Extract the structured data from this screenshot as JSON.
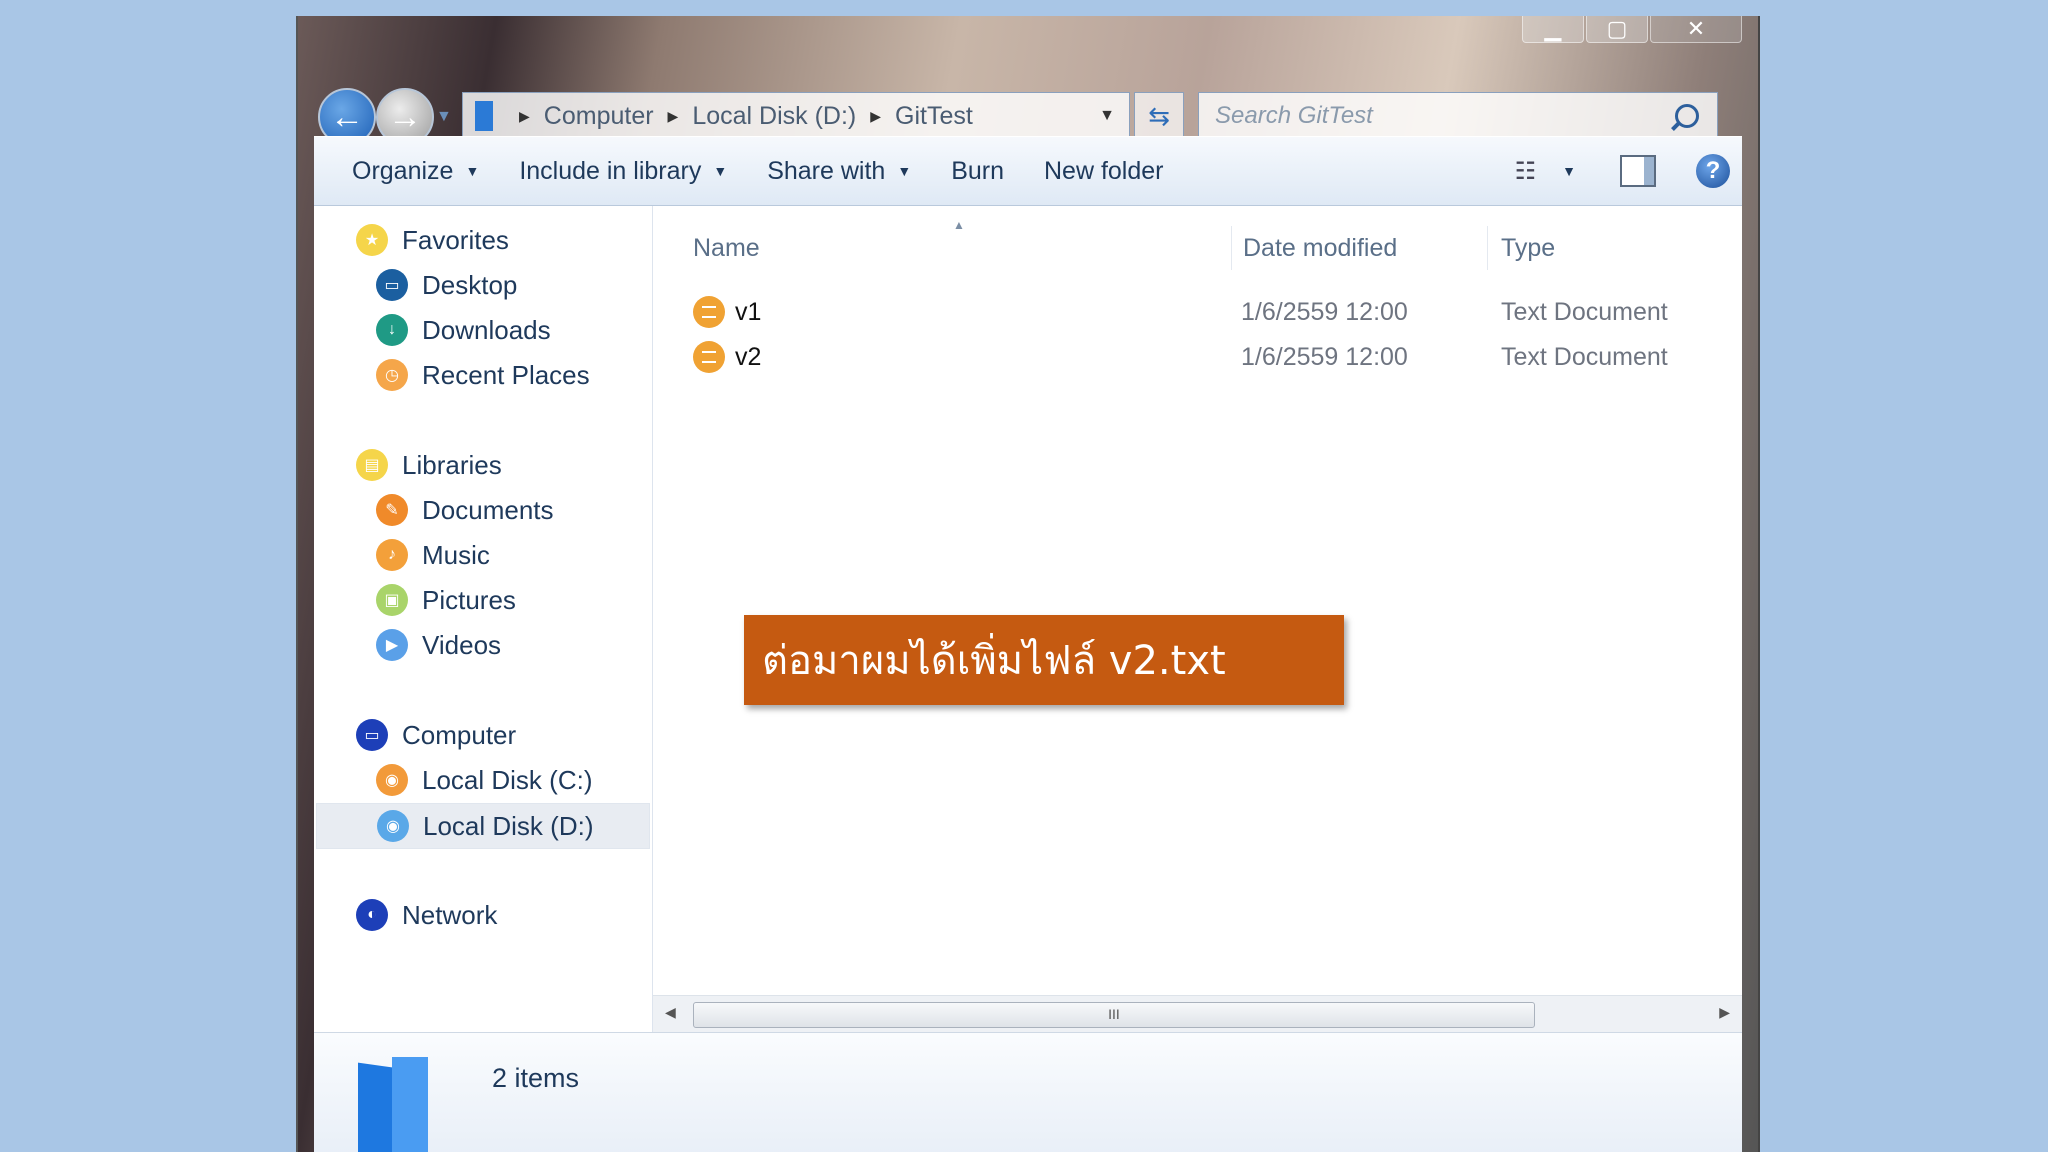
{
  "window": {
    "caption_buttons": {
      "minimize": "▁",
      "maximize": "▢",
      "close": "✕"
    }
  },
  "navigation": {
    "back_icon": "arrow-left",
    "forward_icon": "arrow-right",
    "address_crumbs": [
      "Computer",
      "Local Disk (D:)",
      "GitTest"
    ],
    "search_placeholder": "Search GitTest"
  },
  "toolbar": {
    "items": [
      {
        "label": "Organize",
        "dropdown": true
      },
      {
        "label": "Include in library",
        "dropdown": true
      },
      {
        "label": "Share with",
        "dropdown": true
      },
      {
        "label": "Burn",
        "dropdown": false
      },
      {
        "label": "New folder",
        "dropdown": false
      }
    ]
  },
  "sidebar": {
    "favorites": {
      "label": "Favorites",
      "items": [
        "Desktop",
        "Downloads",
        "Recent Places"
      ]
    },
    "libraries": {
      "label": "Libraries",
      "items": [
        "Documents",
        "Music",
        "Pictures",
        "Videos"
      ]
    },
    "computer": {
      "label": "Computer",
      "items": [
        "Local Disk (C:)",
        "Local Disk (D:)"
      ],
      "selected": "Local Disk (D:)"
    },
    "network": {
      "label": "Network"
    }
  },
  "file_list": {
    "columns": [
      "Name",
      "Date modified",
      "Type"
    ],
    "rows": [
      {
        "name": "v1",
        "date": "1/6/2559 12:00",
        "type": "Text Document"
      },
      {
        "name": "v2",
        "date": "1/6/2559 12:00",
        "type": "Text Document"
      }
    ],
    "scroll_thumb_label": "III"
  },
  "details_pane": {
    "items_count": "2 items"
  },
  "callout": {
    "text": "ต่อมาผมได้เพิ่มไฟล์ v2.txt"
  },
  "colors": {
    "accent": "#1e78e0",
    "callout_bg": "#c55a11",
    "file_icon": "#f0a233",
    "background": "#a9c6e6"
  }
}
